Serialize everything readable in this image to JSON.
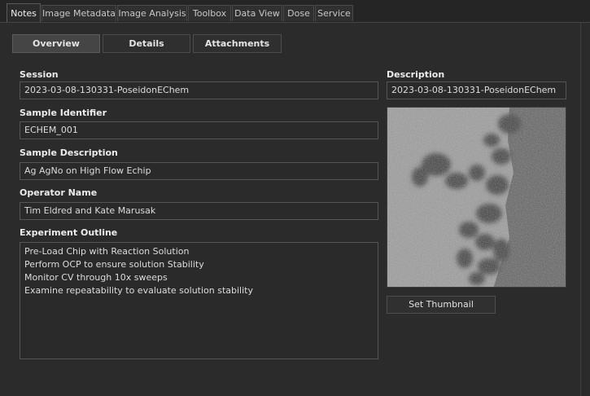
{
  "tabs": [
    "Notes",
    "Image Metadata",
    "Image Analysis",
    "Toolbox",
    "Data View",
    "Dose",
    "Service"
  ],
  "subtabs": [
    "Overview",
    "Details",
    "Attachments"
  ],
  "session": {
    "label": "Session",
    "value": "2023-03-08-130331-PoseidonEChem"
  },
  "sample_identifier": {
    "label": "Sample Identifier",
    "value": "ECHEM_001"
  },
  "sample_description": {
    "label": "Sample Description",
    "value": "Ag AgNo on High Flow Echip"
  },
  "operator_name": {
    "label": "Operator Name",
    "value": "Tim Eldred and Kate Marusak"
  },
  "experiment_outline": {
    "label": "Experiment Outline",
    "lines": [
      "Pre-Load Chip with Reaction Solution",
      "Perform OCP to ensure solution Stability",
      "Monitor CV through 10x sweeps",
      "Examine repeatability to evaluate solution stability"
    ]
  },
  "description": {
    "label": "Description",
    "value": "2023-03-08-130331-PoseidonEChem"
  },
  "set_thumbnail_label": "Set Thumbnail"
}
